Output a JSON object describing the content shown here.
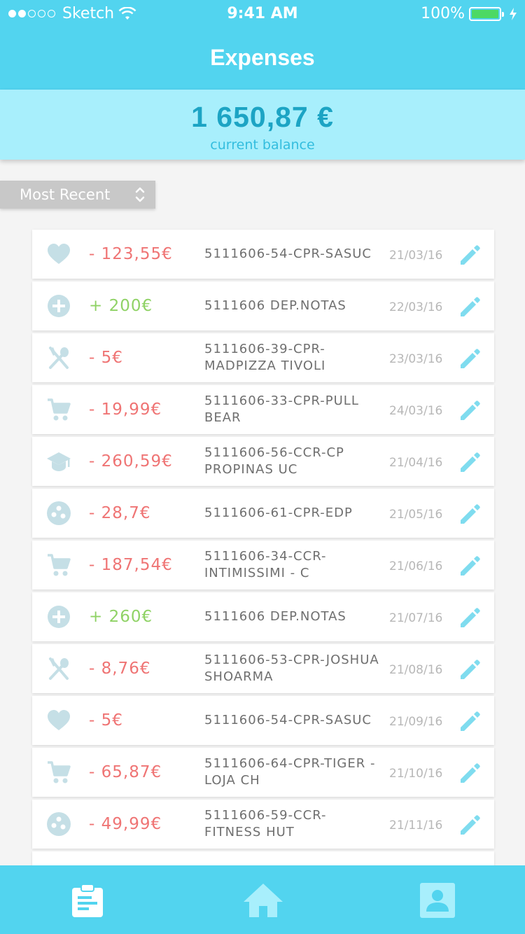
{
  "status_bar": {
    "carrier": "Sketch",
    "time": "9:41 AM",
    "battery": "100%"
  },
  "header": {
    "title": "Expenses"
  },
  "balance": {
    "amount": "1 650,87 €",
    "label": "current balance"
  },
  "sort": {
    "label": "Most Recent"
  },
  "colors": {
    "header": "#52d4ef",
    "balance_panel": "#a8effc",
    "negative": "#ef7474",
    "positive": "#8fd265",
    "icon": "#c5dfe6",
    "edit_icon": "#7fdcef"
  },
  "transactions": [
    {
      "icon": "heart-icon",
      "amount": "- 123,55€",
      "sign": "neg",
      "description": "5111606-54-CPR-SASUC",
      "date": "21/03/16"
    },
    {
      "icon": "plus-circle-icon",
      "amount": "+ 200€",
      "sign": "pos",
      "description": "5111606 DEP.NOTAS",
      "date": "22/03/16"
    },
    {
      "icon": "restaurant-icon",
      "amount": "- 5€",
      "sign": "neg",
      "description": "5111606-39-CPR-MADPIZZA TIVOLI",
      "date": "23/03/16"
    },
    {
      "icon": "cart-icon",
      "amount": "- 19,99€",
      "sign": "neg",
      "description": "5111606-33-CPR-PULL BEAR",
      "date": "24/03/16"
    },
    {
      "icon": "graduation-cap-icon",
      "amount": "- 260,59€",
      "sign": "neg",
      "description": "5111606-56-CCR-CP PROPINAS UC",
      "date": "21/04/16"
    },
    {
      "icon": "bowling-ball-icon",
      "amount": "- 28,7€",
      "sign": "neg",
      "description": "5111606-61-CPR-EDP",
      "date": "21/05/16"
    },
    {
      "icon": "cart-icon",
      "amount": "- 187,54€",
      "sign": "neg",
      "description": "5111606-34-CCR-INTIMISSIMI - C",
      "date": "21/06/16"
    },
    {
      "icon": "plus-circle-icon",
      "amount": "+ 260€",
      "sign": "pos",
      "description": "5111606 DEP.NOTAS",
      "date": "21/07/16"
    },
    {
      "icon": "restaurant-icon",
      "amount": "- 8,76€",
      "sign": "neg",
      "description": "5111606-53-CPR-JOSHUA SHOARMA",
      "date": "21/08/16"
    },
    {
      "icon": "heart-icon",
      "amount": "- 5€",
      "sign": "neg",
      "description": "5111606-54-CPR-SASUC",
      "date": "21/09/16"
    },
    {
      "icon": "cart-icon",
      "amount": "- 65,87€",
      "sign": "neg",
      "description": "5111606-64-CPR-TIGER - LOJA CH",
      "date": "21/10/16"
    },
    {
      "icon": "bowling-ball-icon",
      "amount": "- 49,99€",
      "sign": "neg",
      "description": "5111606-59-CCR-FITNESS HUT",
      "date": "21/11/16"
    }
  ],
  "tabbar": {
    "tabs": [
      {
        "icon": "clipboard-list-icon",
        "active": true
      },
      {
        "icon": "home-icon",
        "active": false
      },
      {
        "icon": "contact-card-icon",
        "active": false
      }
    ]
  }
}
